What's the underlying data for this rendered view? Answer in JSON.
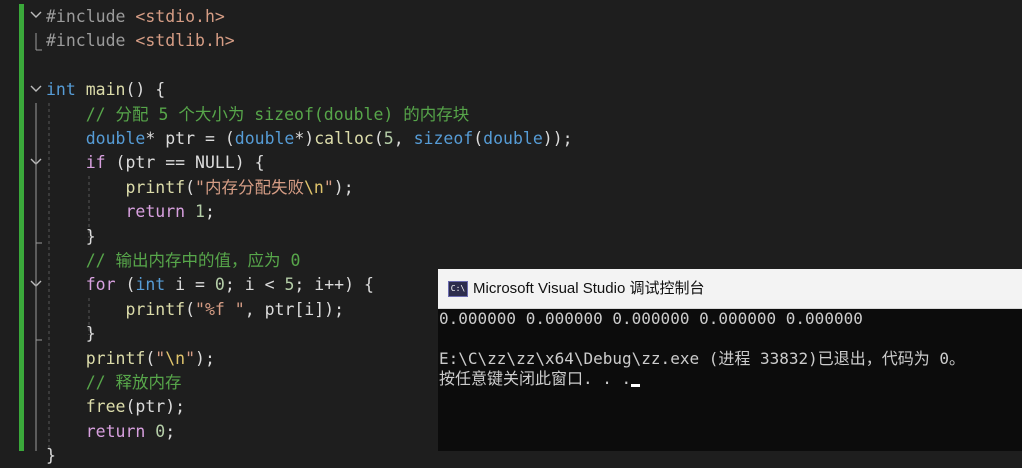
{
  "editor": {
    "lines": [
      {
        "segs": [
          {
            "t": "#include ",
            "c": "inc"
          },
          {
            "t": "<stdio.h>",
            "c": "str"
          }
        ]
      },
      {
        "segs": [
          {
            "t": "#include ",
            "c": "inc"
          },
          {
            "t": "<stdlib.h>",
            "c": "str"
          }
        ]
      },
      {
        "segs": []
      },
      {
        "segs": [
          {
            "t": "int",
            "c": "kw"
          },
          {
            "t": " main",
            "c": "fn"
          },
          {
            "t": "() {",
            "c": "plain"
          }
        ]
      },
      {
        "segs": [
          {
            "t": "    // 分配 5 个大小为 sizeof(double) 的内存块",
            "c": "cmt"
          }
        ]
      },
      {
        "segs": [
          {
            "t": "    ",
            "c": "plain"
          },
          {
            "t": "double",
            "c": "kw"
          },
          {
            "t": "* ptr = (",
            "c": "plain"
          },
          {
            "t": "double",
            "c": "kw"
          },
          {
            "t": "*)",
            "c": "plain"
          },
          {
            "t": "calloc",
            "c": "fn"
          },
          {
            "t": "(",
            "c": "plain"
          },
          {
            "t": "5",
            "c": "num"
          },
          {
            "t": ", ",
            "c": "plain"
          },
          {
            "t": "sizeof",
            "c": "kw"
          },
          {
            "t": "(",
            "c": "plain"
          },
          {
            "t": "double",
            "c": "kw"
          },
          {
            "t": "));",
            "c": "plain"
          }
        ]
      },
      {
        "segs": [
          {
            "t": "    ",
            "c": "plain"
          },
          {
            "t": "if",
            "c": "ctl"
          },
          {
            "t": " (ptr == NULL) {",
            "c": "plain"
          }
        ]
      },
      {
        "segs": [
          {
            "t": "        ",
            "c": "plain"
          },
          {
            "t": "printf",
            "c": "fn"
          },
          {
            "t": "(",
            "c": "plain"
          },
          {
            "t": "\"内存分配失败",
            "c": "str"
          },
          {
            "t": "\\n",
            "c": "esc"
          },
          {
            "t": "\"",
            "c": "str"
          },
          {
            "t": ");",
            "c": "plain"
          }
        ]
      },
      {
        "segs": [
          {
            "t": "        ",
            "c": "plain"
          },
          {
            "t": "return",
            "c": "ctl"
          },
          {
            "t": " ",
            "c": "plain"
          },
          {
            "t": "1",
            "c": "num"
          },
          {
            "t": ";",
            "c": "plain"
          }
        ]
      },
      {
        "segs": [
          {
            "t": "    }",
            "c": "plain"
          }
        ]
      },
      {
        "segs": [
          {
            "t": "    // 输出内存中的值，应为 0",
            "c": "cmt"
          }
        ]
      },
      {
        "segs": [
          {
            "t": "    ",
            "c": "plain"
          },
          {
            "t": "for",
            "c": "ctl"
          },
          {
            "t": " (",
            "c": "plain"
          },
          {
            "t": "int",
            "c": "kw"
          },
          {
            "t": " i = ",
            "c": "plain"
          },
          {
            "t": "0",
            "c": "num"
          },
          {
            "t": "; i < ",
            "c": "plain"
          },
          {
            "t": "5",
            "c": "num"
          },
          {
            "t": "; i++) {",
            "c": "plain"
          }
        ]
      },
      {
        "segs": [
          {
            "t": "        ",
            "c": "plain"
          },
          {
            "t": "printf",
            "c": "fn"
          },
          {
            "t": "(",
            "c": "plain"
          },
          {
            "t": "\"%f \"",
            "c": "str"
          },
          {
            "t": ", ptr[i]);",
            "c": "plain"
          }
        ]
      },
      {
        "segs": [
          {
            "t": "    }",
            "c": "plain"
          }
        ]
      },
      {
        "segs": [
          {
            "t": "    ",
            "c": "plain"
          },
          {
            "t": "printf",
            "c": "fn"
          },
          {
            "t": "(",
            "c": "plain"
          },
          {
            "t": "\"",
            "c": "str"
          },
          {
            "t": "\\n",
            "c": "esc"
          },
          {
            "t": "\"",
            "c": "str"
          },
          {
            "t": ");",
            "c": "plain"
          }
        ]
      },
      {
        "segs": [
          {
            "t": "    // 释放内存",
            "c": "cmt"
          }
        ]
      },
      {
        "segs": [
          {
            "t": "    ",
            "c": "plain"
          },
          {
            "t": "free",
            "c": "fn"
          },
          {
            "t": "(ptr);",
            "c": "plain"
          }
        ]
      },
      {
        "segs": [
          {
            "t": "    ",
            "c": "plain"
          },
          {
            "t": "return",
            "c": "ctl"
          },
          {
            "t": " ",
            "c": "plain"
          },
          {
            "t": "0",
            "c": "num"
          },
          {
            "t": ";",
            "c": "plain"
          }
        ]
      },
      {
        "segs": [
          {
            "t": "}",
            "c": "plain"
          }
        ]
      }
    ]
  },
  "console": {
    "title": "Microsoft Visual Studio 调试控制台",
    "icon": "console-app-icon",
    "output_line1": "0.000000 0.000000 0.000000 0.000000 0.000000",
    "output_line2": "",
    "output_line3": "E:\\C\\zz\\zz\\x64\\Debug\\zz.exe (进程 33832)已退出，代码为 0。",
    "output_line4": "按任意键关闭此窗口. . ."
  }
}
